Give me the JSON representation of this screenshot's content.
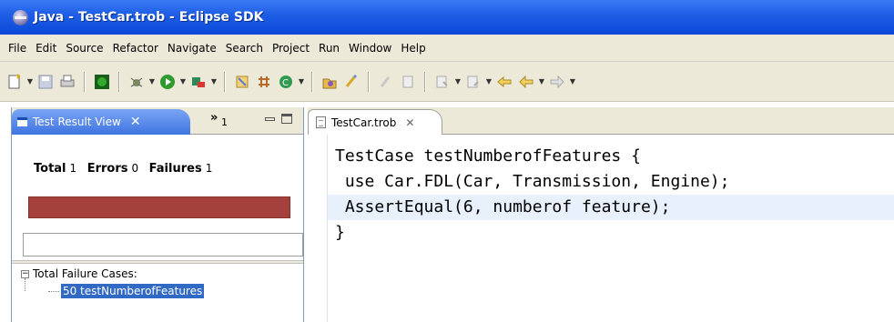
{
  "window": {
    "title": "Java - TestCar.trob - Eclipse SDK"
  },
  "menu": [
    "File",
    "Edit",
    "Source",
    "Refactor",
    "Navigate",
    "Search",
    "Project",
    "Run",
    "Window",
    "Help"
  ],
  "test_view": {
    "tab_label": "Test Result View",
    "overflow_count": "1",
    "summary": {
      "total_label": "Total",
      "total_value": "1",
      "errors_label": "Errors",
      "errors_value": "0",
      "failures_label": "Failures",
      "failures_value": "1"
    },
    "status_color": "#a5413d",
    "tree": {
      "root_label": "Total Failure Cases:",
      "children": [
        "50 testNumberofFeatures"
      ]
    }
  },
  "editor": {
    "tab_label": "TestCar.trob",
    "lines": [
      "TestCase testNumberofFeatures {",
      " use Car.FDL(Car, Transmission, Engine);",
      " AssertEqual(6, numberof feature);",
      "}"
    ],
    "current_line_index": 2
  }
}
